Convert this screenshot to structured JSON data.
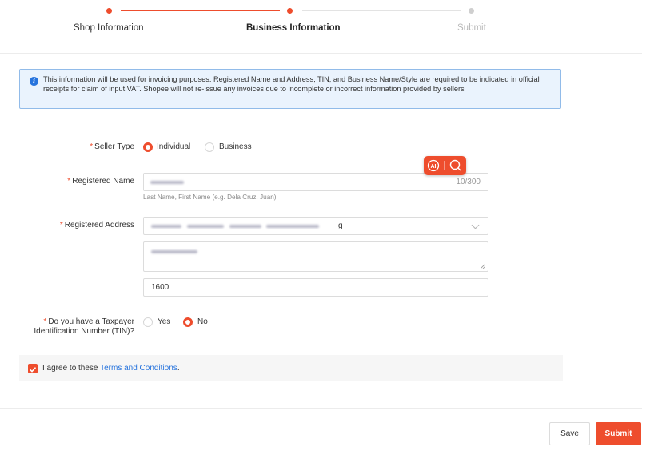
{
  "stepper": {
    "steps": [
      {
        "label": "Shop Information",
        "state": "done"
      },
      {
        "label": "Business Information",
        "state": "current"
      },
      {
        "label": "Submit",
        "state": "future"
      }
    ]
  },
  "banner": {
    "icon": "info-icon",
    "text": "This information will be used for invoicing purposes. Registered Name and Address, TIN, and Business Name/Style are required to be indicated in official receipts for claim of input VAT. Shopee will not re-issue any invoices due to incomplete or incorrect information provided by sellers"
  },
  "form": {
    "required_mark": "*",
    "seller_type": {
      "label": "Seller Type",
      "options": [
        "Individual",
        "Business"
      ],
      "selected": "Individual"
    },
    "registered_name": {
      "label": "Registered Name",
      "counter": "10/300",
      "helper": "Last Name, First Name (e.g. Dela Cruz, Juan)"
    },
    "registered_address": {
      "label": "Registered Address",
      "region_suffix": "g",
      "postal_code": "1600"
    },
    "tin": {
      "label_line1": "Do you have a Taxpayer",
      "label_line2": "Identification Number (TIN)?",
      "options": [
        "Yes",
        "No"
      ],
      "selected": "No"
    }
  },
  "agree": {
    "text": "I agree to these ",
    "link": "Terms and Conditions",
    "suffix": "."
  },
  "footer": {
    "save_label": "Save",
    "submit_label": "Submit"
  },
  "colors": {
    "accent": "#ee4d2d",
    "link": "#2673dd",
    "banner_bg": "#eaf3fd"
  }
}
